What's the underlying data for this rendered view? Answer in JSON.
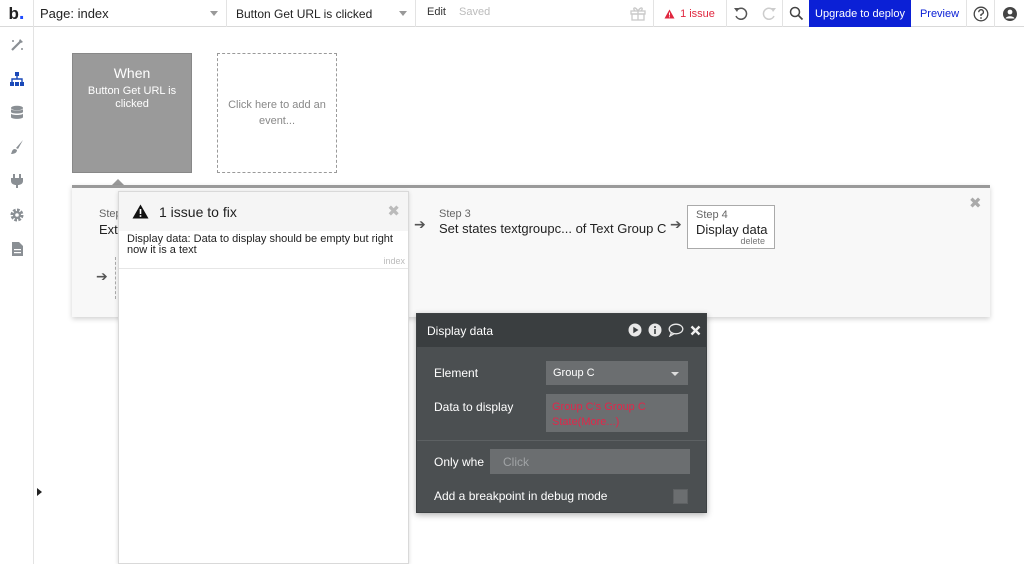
{
  "topbar": {
    "logo": "b",
    "page_selector": "Page: index",
    "workflow_selector": "Button Get URL is clicked",
    "edit_label": "Edit",
    "saved_label": "Saved",
    "issue_count_label": "1 issue",
    "upgrade_label": "Upgrade to deploy",
    "preview_label": "Preview"
  },
  "left_rail": {
    "icons": [
      "design-icon",
      "workflow-icon",
      "data-icon",
      "styles-icon",
      "plugins-icon",
      "settings-icon",
      "logs-icon"
    ],
    "active": "workflow-icon"
  },
  "events": {
    "when_title": "When",
    "when_subtitle": "Button Get URL is clicked",
    "add_event": "Click here to add an event..."
  },
  "steps": {
    "step1_label": "Step",
    "step1_title": "Extr",
    "step3_label": "Step 3",
    "step3_title": "Set states textgroupc... of Text Group C",
    "step4_label": "Step 4",
    "step4_title": "Display data",
    "step4_delete": "delete"
  },
  "issues_panel": {
    "title": "1 issue to fix",
    "items": [
      {
        "text": "Display data: Data to display should be empty but right now it is a text",
        "page": "index"
      }
    ]
  },
  "display_data_dialog": {
    "title": "Display data",
    "element_label": "Element",
    "element_value": "Group C",
    "data_label": "Data to display",
    "data_value": "Group C's Group C State(More...)",
    "only_when_label": "Only whe",
    "only_when_placeholder": "Click",
    "breakpoint_label": "Add a breakpoint in debug mode",
    "breakpoint_checked": false
  },
  "colors": {
    "accent_blue": "#0b20d6",
    "issue_red": "#e0273f",
    "dialog_bg": "#4b4f51",
    "event_card_bg": "#9a9a9a"
  }
}
